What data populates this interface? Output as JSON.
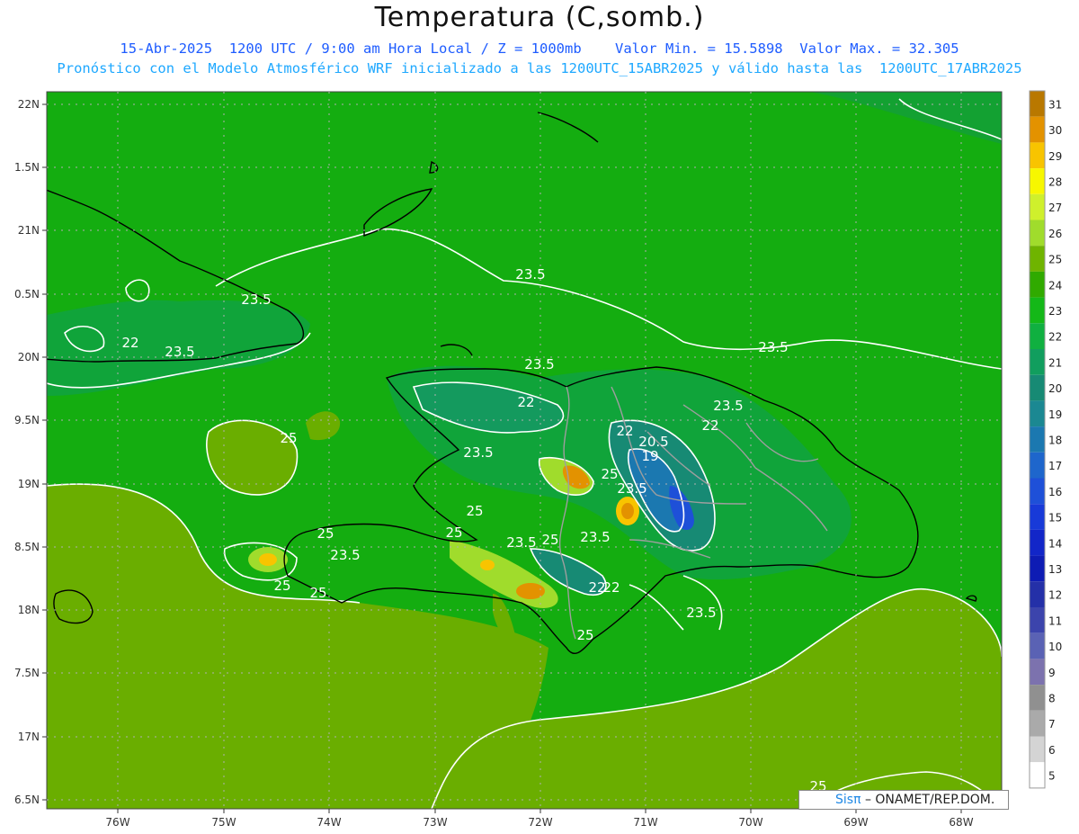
{
  "header": {
    "title": "Temperatura (C,somb.)",
    "line1": "15-Abr-2025  1200 UTC / 9:00 am Hora Local / Z = 1000mb    Valor Min. = 15.5898  Valor Max. = 32.305",
    "line2": "Pronóstico con el Modelo Atmosférico WRF inicializado a las 1200UTC_15ABR2025 y válido hasta las  1200UTC_17ABR2025"
  },
  "credit": {
    "brand": "Sisπ",
    "text": " – ONAMET/REP.DOM."
  },
  "map": {
    "lon_ticks": [
      "76W",
      "75W",
      "74W",
      "73W",
      "72W",
      "71W",
      "70W",
      "69W",
      "68W"
    ],
    "lat_ticks": [
      "22N",
      "1.5N",
      "21N",
      "0.5N",
      "20N",
      "9.5N",
      "19N",
      "8.5N",
      "18N",
      "7.5N",
      "17N",
      "6.5N"
    ],
    "contour_labels": [
      "23.5",
      "23.5",
      "23.5",
      "22",
      "23.5",
      "23.5",
      "22",
      "22",
      "23.5",
      "22",
      "22",
      "20.5",
      "19",
      "23.5",
      "25",
      "25",
      "23.5",
      "25",
      "23.5",
      "25",
      "25",
      "23.5",
      "22",
      "23.5",
      "25",
      "25",
      "25",
      "25",
      "23.5"
    ]
  },
  "colorbar": {
    "labels": [
      "31",
      "30",
      "29",
      "28",
      "27",
      "26",
      "25",
      "24",
      "23",
      "22",
      "21",
      "20",
      "19",
      "18",
      "17",
      "16",
      "15",
      "14",
      "13",
      "12",
      "11",
      "10",
      "9",
      "8",
      "7",
      "6",
      "5"
    ],
    "colors": [
      "#b97800",
      "#e39200",
      "#f8c400",
      "#f7f700",
      "#cff02c",
      "#a0dc2c",
      "#6fb400",
      "#30aa00",
      "#14b818",
      "#10b040",
      "#119e5e",
      "#178a74",
      "#1b8892",
      "#1b78b0",
      "#1e66cc",
      "#1e50d8",
      "#183ad8",
      "#1226c8",
      "#0e1cb4",
      "#2430a8",
      "#3c44ac",
      "#5a62b4",
      "#7c72ae",
      "#909090",
      "#aaaaaa",
      "#d4d4d4",
      "#ffffff"
    ]
  }
}
